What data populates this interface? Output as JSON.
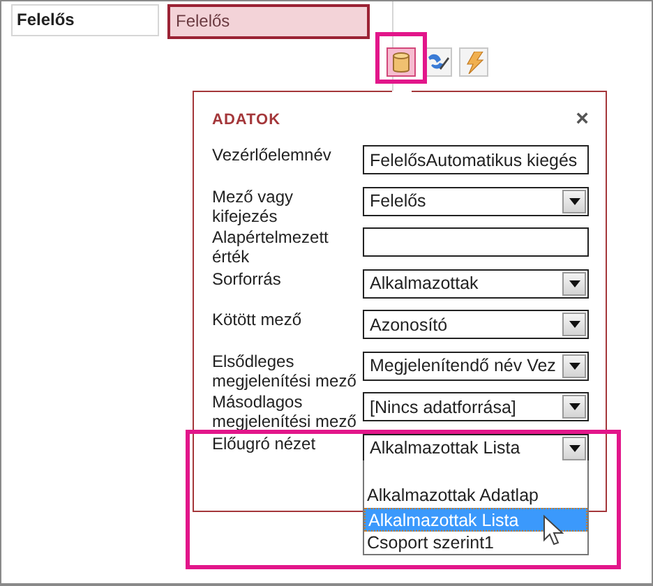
{
  "header": {
    "label": "Felelős",
    "field_value": "Felelős"
  },
  "toolbar": [
    {
      "kind": "data",
      "selected": true
    },
    {
      "kind": "format",
      "selected": false
    },
    {
      "kind": "action",
      "selected": false
    }
  ],
  "panel": {
    "title": "ADATOK",
    "close": "×",
    "rows": [
      {
        "label": "Vezérlőelemnév",
        "kind": "text",
        "value": "FelelősAutomatikus kiegés"
      },
      {
        "label": "Mező vagy kifejezés",
        "kind": "combo",
        "value": "Felelős"
      },
      {
        "label": "Alapértelmezett érték",
        "kind": "text",
        "value": ""
      },
      {
        "label": "Sorforrás",
        "kind": "combo",
        "value": "Alkalmazottak"
      },
      {
        "label": "Kötött mező",
        "kind": "combo",
        "value": "Azonosító"
      },
      {
        "label": "Elsődleges megjelenítési mező",
        "kind": "combo",
        "value": "Megjelenítendő név Vez"
      },
      {
        "label": "Másodlagos megjelenítési mező",
        "kind": "combo",
        "value": "[Nincs adatforrása]"
      },
      {
        "label": "Előugró nézet",
        "kind": "combo",
        "value": "Alkalmazottak Lista",
        "open": true
      }
    ]
  },
  "dropdown_options": [
    {
      "label": "Alkalmazottak Adatlap",
      "selected": false
    },
    {
      "label": "Alkalmazottak Lista",
      "selected": true
    },
    {
      "label": "Csoport szerint1",
      "selected": false
    }
  ]
}
